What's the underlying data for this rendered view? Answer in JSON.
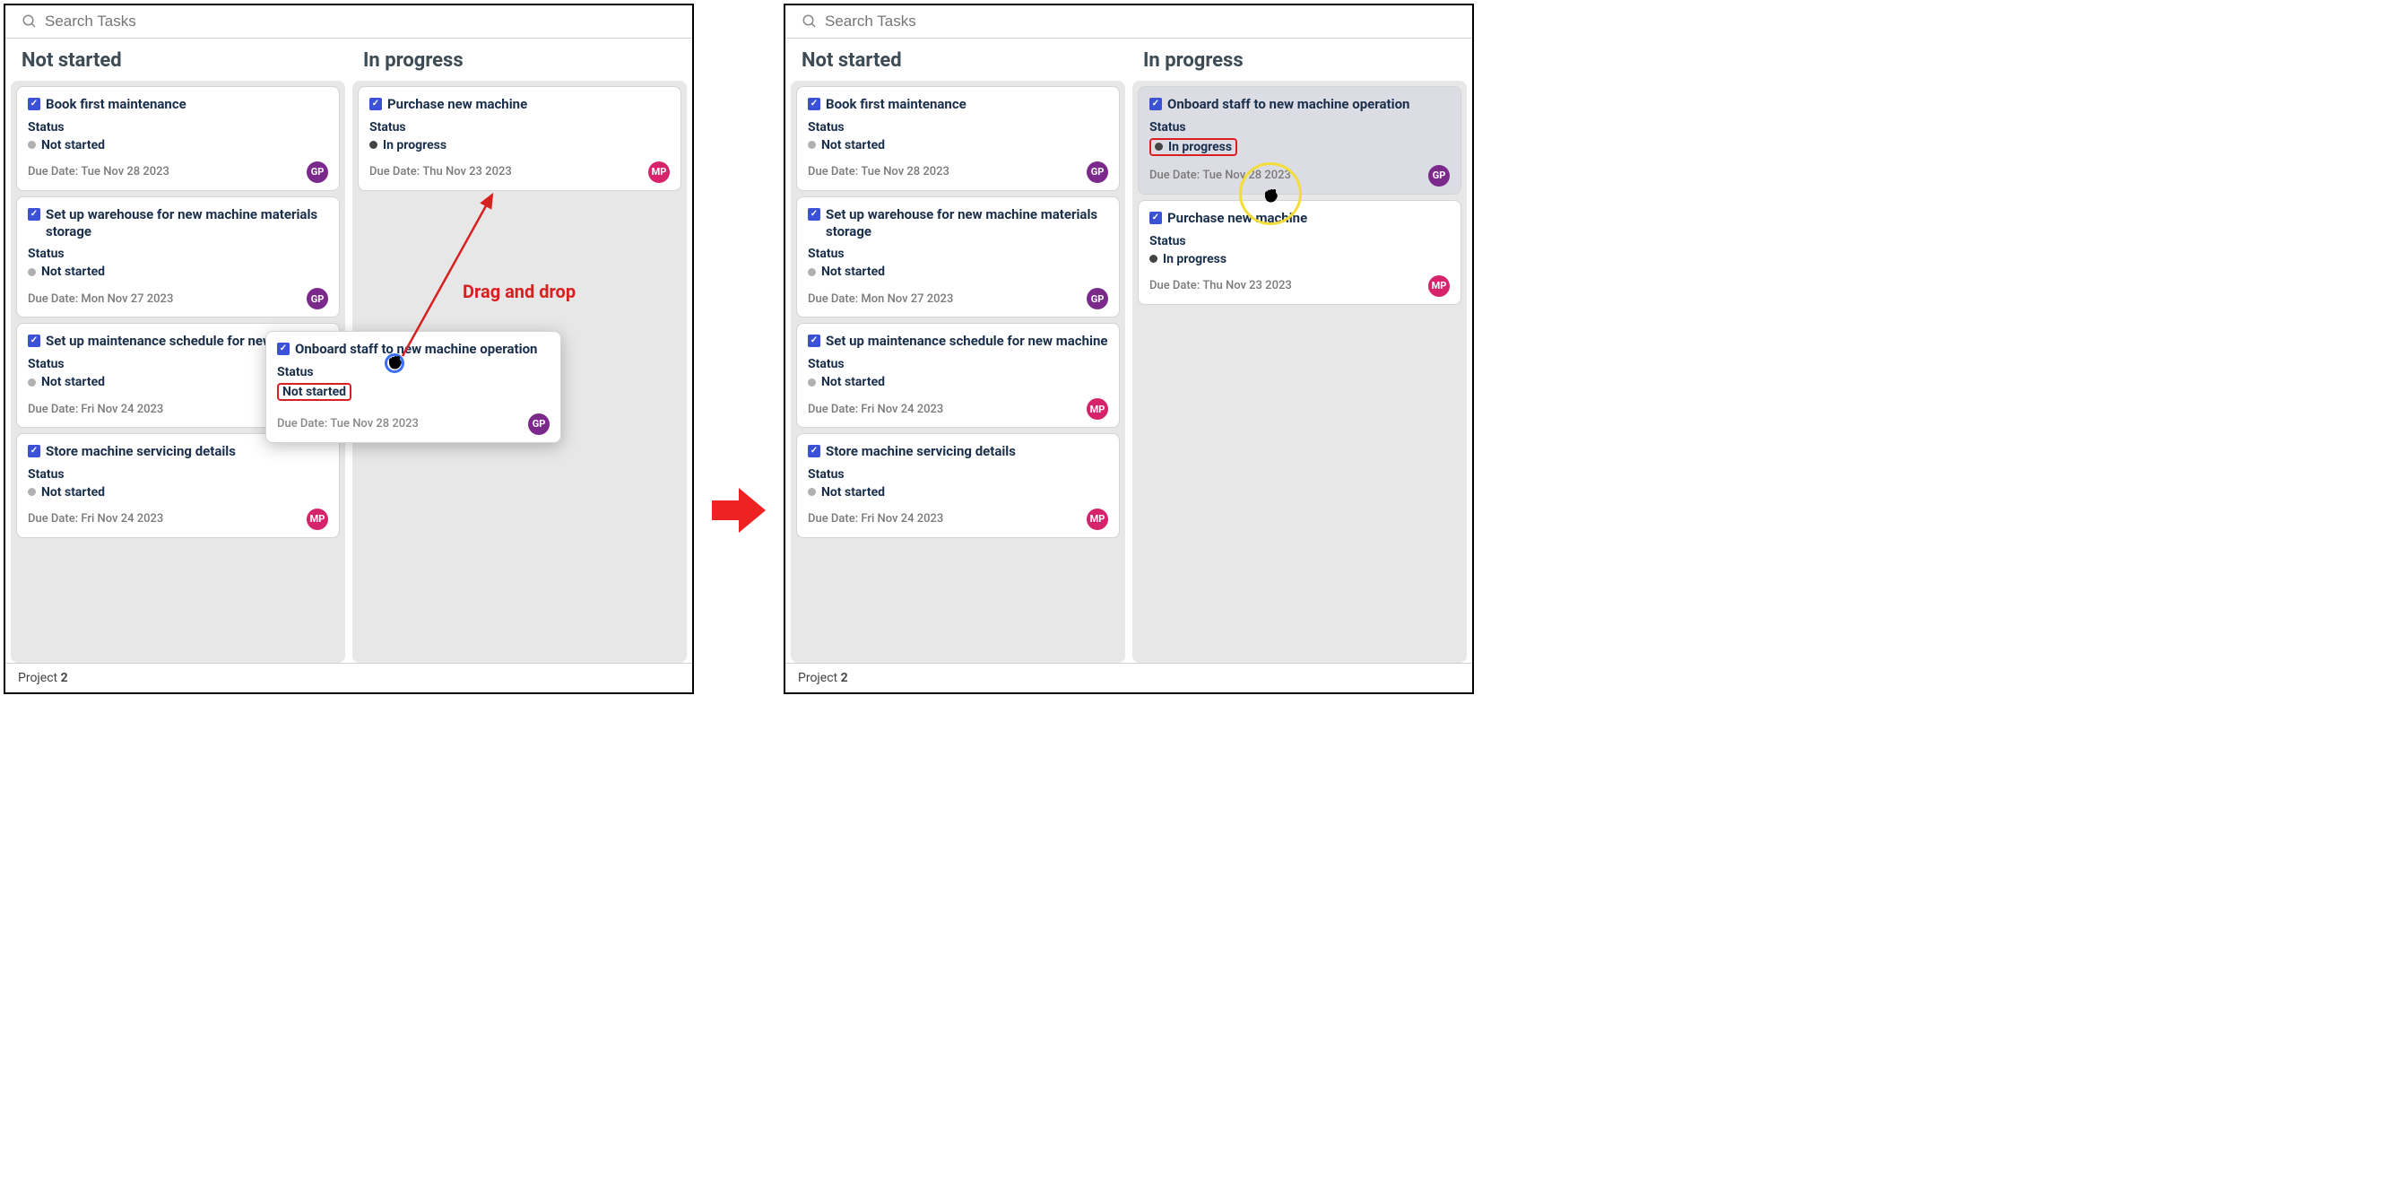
{
  "search": {
    "placeholder": "Search Tasks"
  },
  "columns": {
    "not_started": "Not started",
    "in_progress": "In progress"
  },
  "labels": {
    "status": "Status",
    "due_prefix": "Due Date:"
  },
  "status_values": {
    "not_started": "Not started",
    "in_progress": "In progress"
  },
  "avatars": {
    "gp": "GP",
    "mp": "MP"
  },
  "annotation": {
    "drag_drop": "Drag and drop"
  },
  "footer": {
    "prefix": "Project ",
    "number": "2"
  },
  "left": {
    "not_started": [
      {
        "title": "Book first maintenance",
        "status": "not_started",
        "due": "Tue Nov 28 2023",
        "avatar": "gp"
      },
      {
        "title": "Set up warehouse for new machine materials storage",
        "status": "not_started",
        "due": "Mon Nov 27 2023",
        "avatar": "gp"
      },
      {
        "title": "Set up maintenance schedule for new machine",
        "status": "not_started",
        "due": "Fri Nov 24 2023",
        "avatar": "mp"
      },
      {
        "title": "Store machine servicing details",
        "status": "not_started",
        "due": "Fri Nov 24 2023",
        "avatar": "mp"
      }
    ],
    "in_progress": [
      {
        "title": "Purchase new machine",
        "status": "in_progress",
        "due": "Thu Nov 23 2023",
        "avatar": "mp"
      }
    ],
    "dragging": {
      "title": "Onboard staff to new machine operation",
      "status": "not_started",
      "due": "Tue Nov 28 2023",
      "avatar": "gp"
    }
  },
  "right": {
    "not_started": [
      {
        "title": "Book first maintenance",
        "status": "not_started",
        "due": "Tue Nov 28 2023",
        "avatar": "gp"
      },
      {
        "title": "Set up warehouse for new machine materials storage",
        "status": "not_started",
        "due": "Mon Nov 27 2023",
        "avatar": "gp"
      },
      {
        "title": "Set up maintenance schedule for new machine",
        "status": "not_started",
        "due": "Fri Nov 24 2023",
        "avatar": "mp"
      },
      {
        "title": "Store machine servicing details",
        "status": "not_started",
        "due": "Fri Nov 24 2023",
        "avatar": "mp"
      }
    ],
    "in_progress": [
      {
        "title": "Onboard staff to new machine operation",
        "status": "in_progress",
        "due": "Tue Nov 28 2023",
        "avatar": "gp",
        "dropped": true
      },
      {
        "title": "Purchase new machine",
        "status": "in_progress",
        "due": "Thu Nov 23 2023",
        "avatar": "mp"
      }
    ]
  }
}
